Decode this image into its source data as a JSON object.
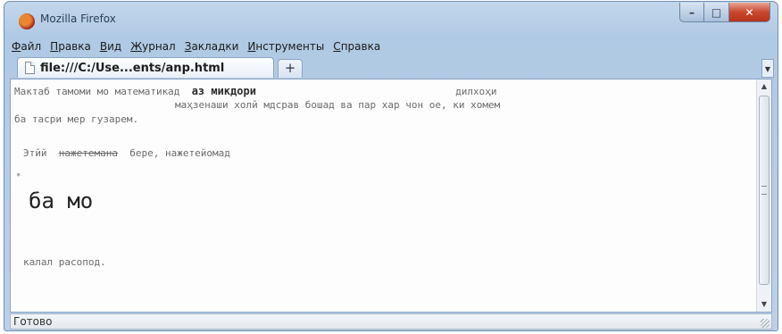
{
  "window": {
    "title": "Mozilla Firefox",
    "controls": {
      "minimize": "–",
      "maximize": "□",
      "close": "✕"
    }
  },
  "menubar": {
    "items": [
      {
        "accel": "Ф",
        "rest": "айл"
      },
      {
        "accel": "П",
        "rest": "равка"
      },
      {
        "accel": "В",
        "rest": "ид"
      },
      {
        "accel": "Ж",
        "rest": "урнал"
      },
      {
        "accel": "З",
        "rest": "акладки"
      },
      {
        "accel": "И",
        "rest": "нструменты"
      },
      {
        "accel": "С",
        "rest": "правка"
      }
    ]
  },
  "tabs": {
    "active_title": "file:///C:/Use...ents/anp.html",
    "new_tab": "+",
    "list_arrow": "▼"
  },
  "content": {
    "line1_start": "Мактаб тамоми мо математикад",
    "line1_bold": "аз микдори",
    "line1_end": "дилхоҳи",
    "line2": "маҳзенаши холй  мдсрав бошад ва пар хар чон оe, ки хомем",
    "line3": "ба тасри мер гузарем.",
    "line4_start": "Этйй",
    "line4_strike": "нажетемана",
    "line4_end": "бере, нажетейомад",
    "mark": "*",
    "heading": "ба мо",
    "line6": "калал расопод."
  },
  "scrollbar": {
    "up": "▲",
    "down": "▼"
  },
  "status": {
    "text": "Готово"
  }
}
